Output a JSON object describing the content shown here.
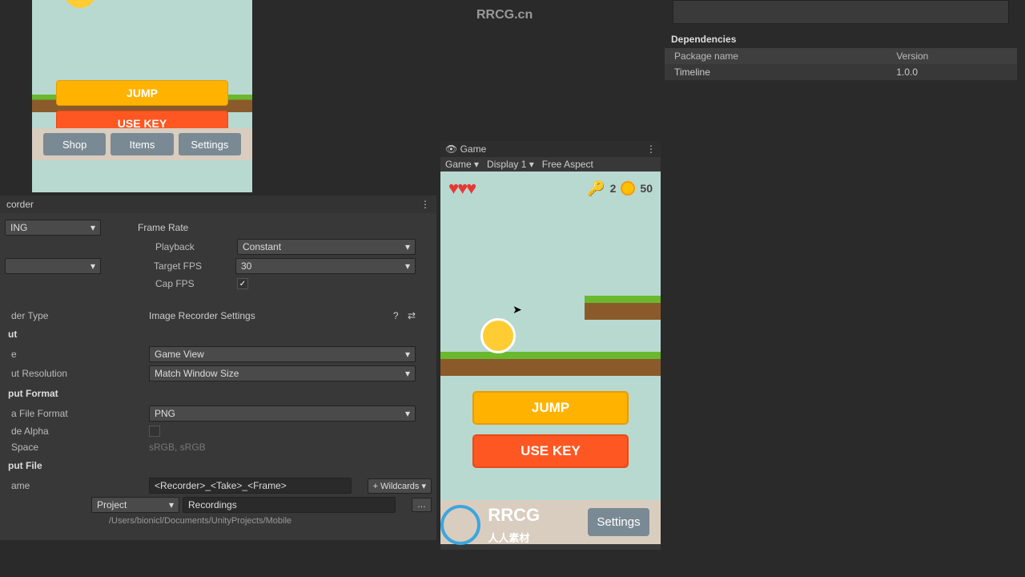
{
  "watermark_top": "RRCG.cn",
  "scene": {
    "jump": "JUMP",
    "usekey": "USE KEY",
    "shop": "Shop",
    "items": "Items",
    "settings": "Settings"
  },
  "recorder": {
    "tab": "corder",
    "status": "ING",
    "framerate_label": "Frame Rate",
    "playback_label": "Playback",
    "playback_value": "Constant",
    "targetfps_label": "Target FPS",
    "targetfps_value": "30",
    "capfps_label": "Cap FPS",
    "capfps_checked": "✓",
    "type_label": "der Type",
    "type_value": "Image Recorder Settings",
    "input_section": "ut",
    "source_label": "e",
    "source_value": "Game View",
    "resolution_label": "ut Resolution",
    "resolution_value": "Match Window Size",
    "format_section": "put Format",
    "fileformat_label": "a File Format",
    "fileformat_value": "PNG",
    "alpha_label": "de Alpha",
    "space_label": "Space",
    "space_value": "sRGB, sRGB",
    "file_section": "put File",
    "name_label": "ame",
    "name_value": "<Recorder>_<Take>_<Frame>",
    "wildcards": "+ Wildcards",
    "project": "Project",
    "recordings": "Recordings",
    "path": "/Users/bionicl/Documents/UnityProjects/Mobile"
  },
  "game": {
    "tab": "Game",
    "mode": "Game",
    "display": "Display 1",
    "aspect": "Free Aspect",
    "keys": "2",
    "coins": "50",
    "jump": "JUMP",
    "usekey": "USE KEY",
    "settings": "Settings"
  },
  "inspector": {
    "deps": "Dependencies",
    "col_package": "Package name",
    "col_version": "Version",
    "row_name": "Timeline",
    "row_version": "1.0.0"
  },
  "logo": {
    "text": "RRCG",
    "sub": "人人素材"
  }
}
